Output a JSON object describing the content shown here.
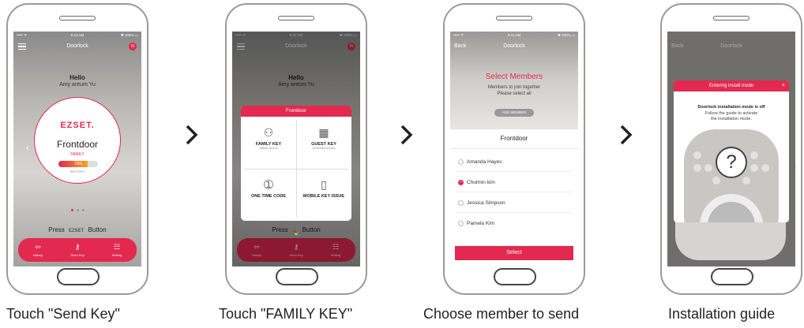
{
  "steps": [
    {
      "caption": "Touch \"Send Key\"",
      "status": {
        "left": "••••• ᯤ",
        "time": "9:41 AM",
        "right": "✱ 100% ▭"
      },
      "nav": {
        "title": "Doorlock",
        "badge": "N"
      },
      "hello": "Hello",
      "user": "Amy areum Yu",
      "brand": "EZSET.",
      "door": "Frontdoor",
      "role": "FAMILY",
      "battery": {
        "percent": 73,
        "label_text": "73%",
        "caption": "BATTERY"
      },
      "press": {
        "before": "Press",
        "logo": "EZSET",
        "after": "Button"
      },
      "tabs": [
        {
          "label": "History",
          "icon": "history-icon",
          "glyph": "⇦"
        },
        {
          "label": "Send Key",
          "icon": "key-icon",
          "glyph": "⚷"
        },
        {
          "label": "Setting",
          "icon": "sliders-icon",
          "glyph": "☷"
        }
      ]
    },
    {
      "caption": "Touch \"FAMILY KEY\"",
      "modal_title": "Frontdoor",
      "options": [
        {
          "title": "FAMILY KEY",
          "sub": "Always access",
          "glyph": "⚇"
        },
        {
          "title": "GUEST KEY",
          "sub": "Scheduled access",
          "glyph": "▦"
        },
        {
          "title": "ONE TIME CODE",
          "sub": "",
          "glyph": "➀"
        },
        {
          "title": "MOBILE KEY ISSUE",
          "sub": "",
          "glyph": "▯"
        }
      ],
      "press_after": "Button"
    },
    {
      "caption": "Choose member to send",
      "status": {
        "left": "••••• ᯤ",
        "time": "9:41 AM",
        "right": "✱ 100% ▭"
      },
      "nav": {
        "back": "Back",
        "title": "Doorlock"
      },
      "title": "Select Members",
      "sub1": "Members to join together",
      "sub2": "Please select all",
      "add_member": "ADD MEMBER",
      "list_title": "Frontdoor",
      "members": [
        {
          "name": "Amanda Hayes",
          "checked": false
        },
        {
          "name": "Chulmin kim",
          "checked": true
        },
        {
          "name": "Jessica Simpson",
          "checked": false
        },
        {
          "name": "Pamela Kim",
          "checked": false
        }
      ],
      "select_button": "Select"
    },
    {
      "caption": "Installation guide",
      "nav": {
        "back": "Back",
        "title": "Doorlock"
      },
      "dialog_title": "Entering install mode",
      "dialog_close": "×",
      "line1": "Doorlock installation mode is off",
      "line2": "Follow the guide to activate",
      "line3": "the installation mode.",
      "symbol": "?"
    }
  ],
  "colors": {
    "accent": "#e3294f",
    "text": "#222222",
    "frame": "#9a9a9a"
  }
}
